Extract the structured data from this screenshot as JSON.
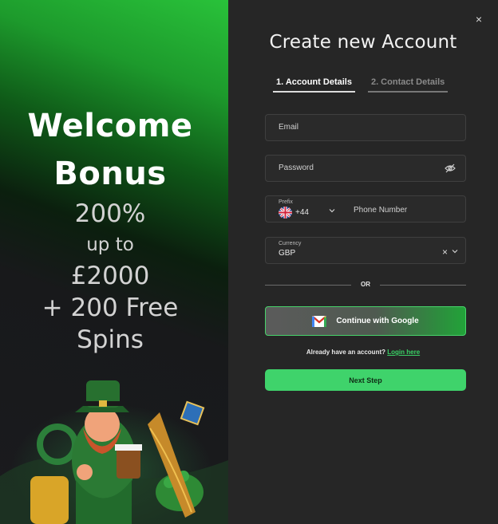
{
  "promo": {
    "title_line1": "Welcome",
    "title_line2": "Bonus",
    "percent": "200%",
    "upto": "up to",
    "amount": "£2000",
    "free_spins_line1": "+ 200 Free",
    "free_spins_line2": "Spins"
  },
  "form": {
    "title": "Create new Account",
    "close_icon": "×",
    "steps": [
      {
        "label": "1. Account Details",
        "active": true
      },
      {
        "label": "2. Contact Details",
        "active": false
      }
    ],
    "email_placeholder": "Email",
    "password_placeholder": "Password",
    "prefix_label": "Prefix",
    "prefix_code": "+44",
    "prefix_flag": "uk-flag",
    "phone_placeholder": "Phone Number",
    "currency_label": "Currency",
    "currency_value": "GBP",
    "clear_icon": "×",
    "or_text": "OR",
    "google_button": "Continue with Google",
    "already_text": "Already have an account?",
    "login_link": "Login here",
    "next_button": "Next Step"
  },
  "colors": {
    "accent_green": "#3fd36b",
    "panel_bg": "#262626"
  }
}
